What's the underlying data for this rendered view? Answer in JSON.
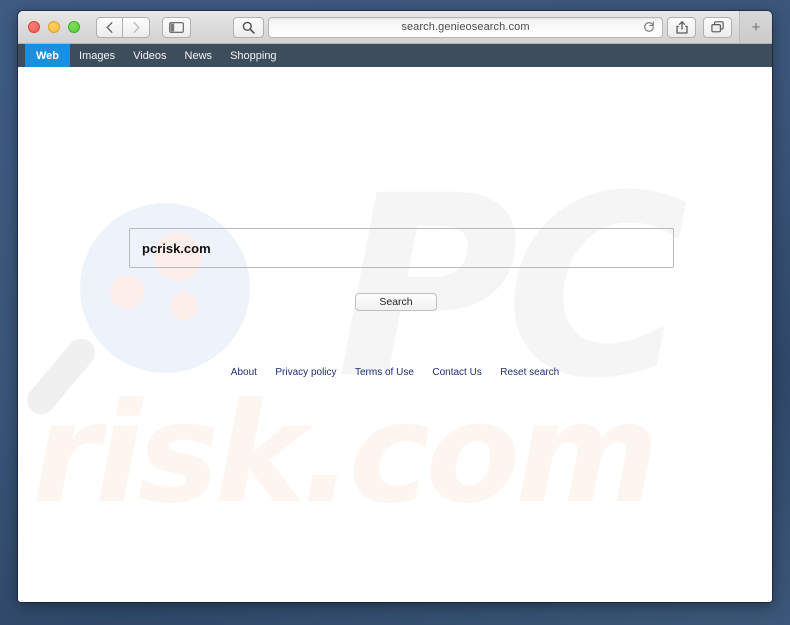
{
  "window": {
    "traffic_lights": [
      "close",
      "minimize",
      "maximize"
    ],
    "back_label": "back",
    "forward_label": "forward",
    "sidebar_label": "sidebar",
    "search_tool_label": "search",
    "share_label": "share",
    "tabs_label": "show-tabs",
    "new_tab_label": "+"
  },
  "address_bar": {
    "url": "search.genieosearch.com",
    "reload_label": "reload"
  },
  "site_nav": {
    "items": [
      {
        "label": "Web",
        "active": true
      },
      {
        "label": "Images",
        "active": false
      },
      {
        "label": "Videos",
        "active": false
      },
      {
        "label": "News",
        "active": false
      },
      {
        "label": "Shopping",
        "active": false
      }
    ]
  },
  "search": {
    "query": "pcrisk.com",
    "placeholder": "",
    "button_label": "Search"
  },
  "watermark": {
    "top_text": "PC",
    "bottom_text": "risk.com"
  },
  "footer": {
    "links": [
      "About",
      "Privacy policy",
      "Terms of Use",
      "Contact Us",
      "Reset search"
    ]
  },
  "colors": {
    "nav_bar_bg": "#3d4d5c",
    "nav_active_bg": "#1a8fe0",
    "link_color": "#1e2d78",
    "desktop_bg": "#3d5a82",
    "watermark_gray": "#f5f5f5",
    "watermark_peach": "#fdf5ef",
    "watermark_lens": "#eef3fb",
    "watermark_dot": "#fdeeea"
  }
}
